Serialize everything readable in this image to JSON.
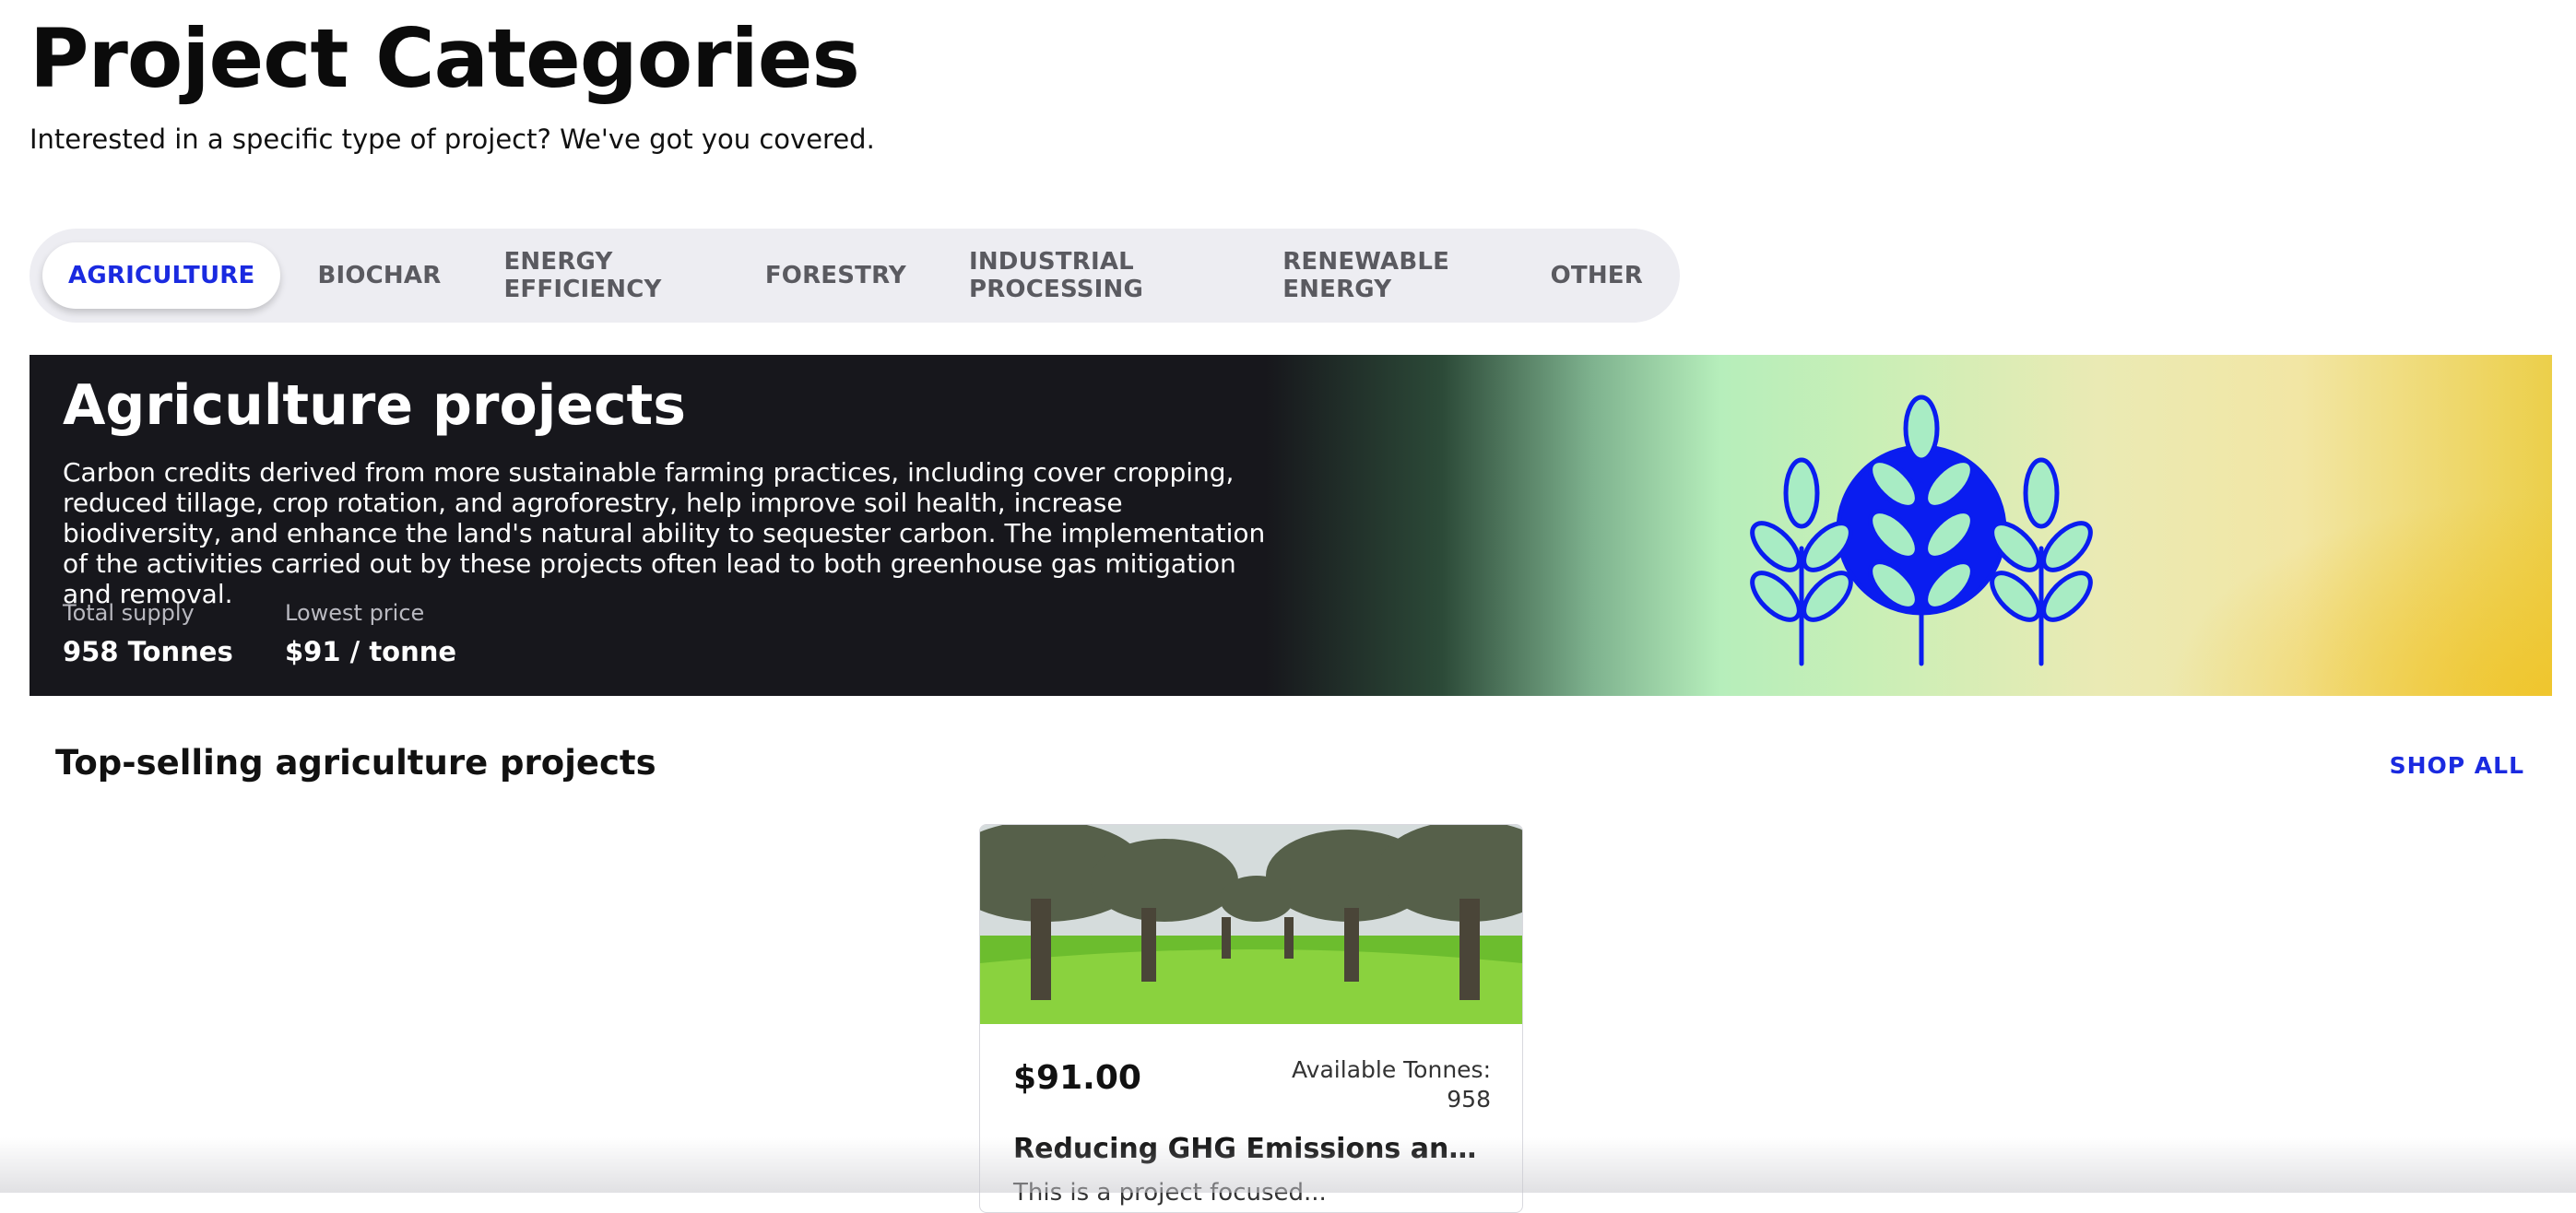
{
  "page": {
    "title": "Project Categories",
    "subtitle": "Interested in a specific type of project? We've got you covered."
  },
  "tabs": [
    {
      "label": "AGRICULTURE",
      "active": true
    },
    {
      "label": "BIOCHAR",
      "active": false
    },
    {
      "label": "ENERGY EFFICIENCY",
      "active": false
    },
    {
      "label": "FORESTRY",
      "active": false
    },
    {
      "label": "INDUSTRIAL PROCESSING",
      "active": false
    },
    {
      "label": "RENEWABLE ENERGY",
      "active": false
    },
    {
      "label": "OTHER",
      "active": false
    }
  ],
  "hero": {
    "title": "Agriculture projects",
    "description": "Carbon credits derived from more sustainable farming practices, including cover cropping, reduced tillage, crop rotation, and agroforestry, help improve soil health, increase biodiversity, and enhance the land's natural ability to sequester carbon. The implementation of the activities carried out by these projects often lead to both greenhouse gas mitigation and removal.",
    "stats": {
      "supply_label": "Total supply",
      "supply_value": "958 Tonnes",
      "price_label": "Lowest price",
      "price_value": "$91 / tonne"
    },
    "icon": "wheat-icon"
  },
  "section": {
    "title": "Top-selling agriculture projects",
    "shop_all": "SHOP ALL"
  },
  "card": {
    "image": "olive-grove-photo",
    "price": "$91.00",
    "available_label": "Available Tonnes:",
    "available_value": "958",
    "name": "Reducing GHG Emissions and Increasing Carbon Sequestration",
    "description": "This is a project focused..."
  },
  "colors": {
    "accent": "#1a2ae0",
    "hero_dark": "#17171c",
    "tab_bar": "#ededf2",
    "icon_fill": "#0a1df0",
    "leaf_fill": "#a8ecc4"
  }
}
